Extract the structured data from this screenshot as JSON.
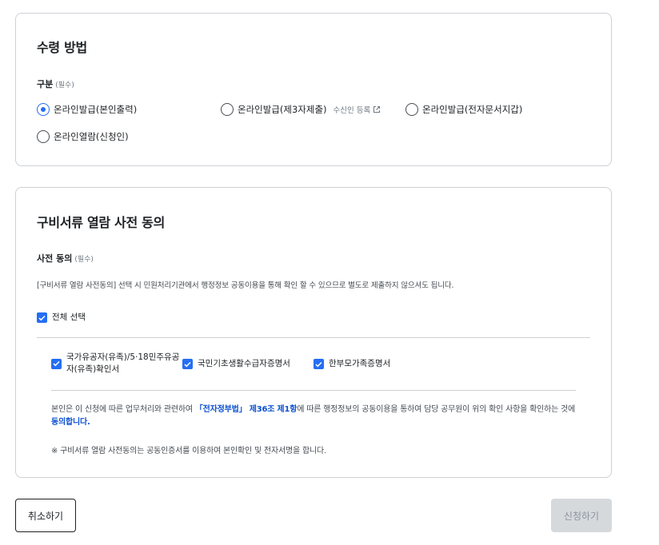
{
  "receipt": {
    "title": "수령 방법",
    "category_label": "구분",
    "required_mark": "(필수)",
    "options": [
      {
        "label": "온라인발급(본인출력)",
        "checked": true
      },
      {
        "label": "온라인발급(제3자제출)",
        "checked": false
      },
      {
        "label": "온라인발급(전자문서지갑)",
        "checked": false
      },
      {
        "label": "온라인열람(신청인)",
        "checked": false
      }
    ],
    "register_link": "수신인 등록"
  },
  "consent": {
    "title": "구비서류 열람 사전 동의",
    "field_label": "사전 동의",
    "required_mark": "(필수)",
    "description": "[구비서류 열람 사전동의] 선택 시 민원처리기관에서 행정정보 공동이용을 통해 확인 할 수 있으므로 별도로 제출하지 않으셔도 됩니다.",
    "select_all": "전체 선택",
    "documents": [
      {
        "label_line1": "국가유공자(유족)/5·18민주유공",
        "label_line2": "자(유족)확인서",
        "checked": true
      },
      {
        "label": "국민기초생활수급자증명서",
        "checked": true
      },
      {
        "label": "한부모가족증명서",
        "checked": true
      }
    ],
    "notice_part1": "본인은 이 신청에 따른 업무처리와 관련하여 ",
    "notice_law": "「전자정부법」 제36조 제1항",
    "notice_part2": "에 따른 행정정보의 공동이용을 통하여 담당 공무원이 위의 확인 사항을 확인하는 것에 ",
    "notice_agree": "동의합니다.",
    "sub_note": "※ 구비서류 열람 사전동의는 공동인증서를 이용하여 본인확인 및 전자서명을 합니다."
  },
  "actions": {
    "cancel": "취소하기",
    "submit": "신청하기"
  },
  "colors": {
    "accent": "#256ef4",
    "highlight_text": "#0b50d0",
    "border": "#cdd1d5",
    "disabled_bg": "#d6d9dc"
  }
}
